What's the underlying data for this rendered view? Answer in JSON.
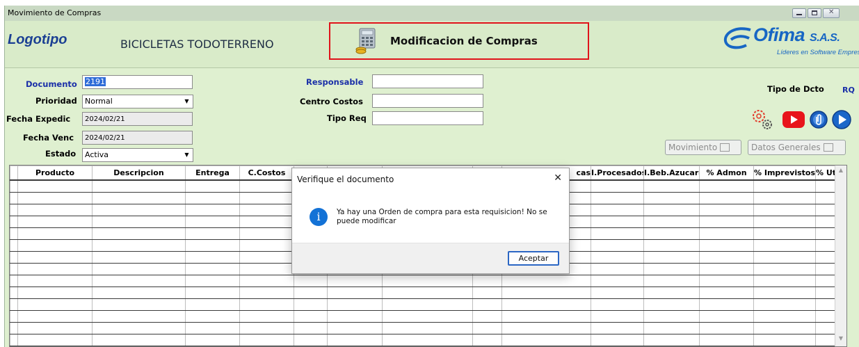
{
  "window": {
    "title": "Movimiento de Compras"
  },
  "header": {
    "logo": "Logotipo",
    "company": "BICICLETAS TODOTERRENO",
    "module_title": "Modificacion de Compras",
    "brand": {
      "name": "Ofima",
      "suffix": "S.A.S.",
      "tagline": "Líderes en Software Empresarial"
    }
  },
  "form": {
    "documento": {
      "label": "Documento",
      "value": "2191"
    },
    "prioridad": {
      "label": "Prioridad",
      "value": "Normal"
    },
    "fecha_expedic": {
      "label": "Fecha Expedic",
      "value": "2024/02/21"
    },
    "fecha_venc": {
      "label": "Fecha Venc",
      "value": "2024/02/21"
    },
    "estado": {
      "label": "Estado",
      "value": "Activa"
    },
    "responsable": {
      "label": "Responsable",
      "value": ""
    },
    "centro_costos": {
      "label": "Centro Costos",
      "value": ""
    },
    "tipo_req": {
      "label": "Tipo Req",
      "value": ""
    },
    "tipo_dcto": {
      "label": "Tipo de Dcto",
      "value": "RQ"
    }
  },
  "toolbar": {
    "icons": [
      "gears-icon",
      "youtube-icon",
      "attachment-icon",
      "play-icon"
    ],
    "movimiento_label": "Movimiento",
    "datos_generales_label": "Datos Generales"
  },
  "grid": {
    "columns": [
      "",
      "Producto",
      "Descripcion",
      "Entrega",
      "C.Costos",
      "",
      "",
      "",
      "",
      "cas",
      "I.Procesados",
      "I.Beb.Azucara",
      "% Admon",
      "% Imprevistos",
      "% Utilid"
    ],
    "row_count": 14
  },
  "dialog": {
    "title": "Verifique el documento",
    "message": "Ya hay una Orden de compra para esta requisicion! No se puede modificar",
    "ok_label": "Aceptar"
  },
  "colors": {
    "accent_red": "#e0131a",
    "label_blue": "#1a2fa8",
    "brand_blue": "#1766c4",
    "panel_green": "#dff0d0"
  }
}
